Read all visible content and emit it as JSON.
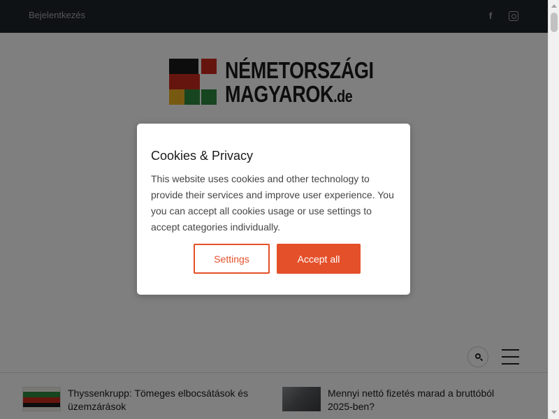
{
  "topbar": {
    "login_label": "Bejelentkezés",
    "social_icons": [
      "facebook-icon",
      "instagram-icon"
    ]
  },
  "logo": {
    "line1": "NÉMETORSZÁGI",
    "line2": "MAGYAROK",
    "suffix": ".de",
    "colors": [
      "#1a1a1a",
      "#cc2a1c",
      "#f0b323",
      "#2e8b3e"
    ]
  },
  "articles": [
    {
      "title": "Thyssenkrupp: Tömeges elbocsátások és üzemzárások"
    },
    {
      "title": "Mennyi nettó fizetés marad a bruttóból 2025-ben?"
    }
  ],
  "cookie_dialog": {
    "title": "Cookies & Privacy",
    "body": "This website uses cookies and other technology to provide their services and improve user experience. You you can accept all cookies usage or use settings to accept categories individually.",
    "settings_label": "Settings",
    "accept_label": "Accept all",
    "accent_color": "#e4502a"
  }
}
